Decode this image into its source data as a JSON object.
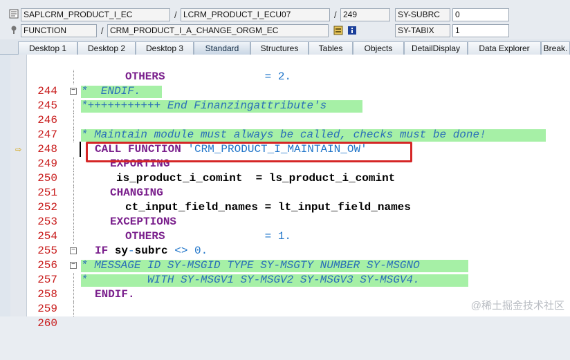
{
  "header": {
    "row1": {
      "program": "SAPLCRM_PRODUCT_I_EC",
      "include": "LCRM_PRODUCT_I_ECU07",
      "line": "249",
      "sysfield": "SY-SUBRC",
      "sysvalue": "0"
    },
    "row2": {
      "type": "FUNCTION",
      "object": "CRM_PRODUCT_I_A_CHANGE_ORGM_EC",
      "sysfield": "SY-TABIX",
      "sysvalue": "1"
    }
  },
  "tabs": [
    {
      "label": "Desktop 1"
    },
    {
      "label": "Desktop 2"
    },
    {
      "label": "Desktop 3"
    },
    {
      "label": "Standard"
    },
    {
      "label": "Structures"
    },
    {
      "label": "Tables"
    },
    {
      "label": "Objects"
    },
    {
      "label": "DetailDisplay"
    },
    {
      "label": "Data Explorer"
    },
    {
      "label": "Break."
    }
  ],
  "code_lines": [
    {
      "n": "244"
    },
    {
      "n": "245"
    },
    {
      "n": "246"
    },
    {
      "n": "247"
    },
    {
      "n": "248"
    },
    {
      "n": "249"
    },
    {
      "n": "250"
    },
    {
      "n": "251"
    },
    {
      "n": "252"
    },
    {
      "n": "253"
    },
    {
      "n": "254"
    },
    {
      "n": "255"
    },
    {
      "n": "256"
    },
    {
      "n": "257"
    },
    {
      "n": "258"
    },
    {
      "n": "259"
    },
    {
      "n": "260"
    }
  ],
  "code": {
    "l244a": "OTHERS",
    "l244b": "= ",
    "l244c": "2",
    "l244d": ".",
    "l245": "*  ENDIF.",
    "l246": "*+++++++++++ End Finanzingattribute's",
    "l248": "* Maintain module must always be called, checks must be done!",
    "l249a": "CALL FUNCTION ",
    "l249b": "'CRM_PRODUCT_I_MAINTAIN_OW'",
    "l250": "EXPORTING",
    "l251a": "is_product_i_comint",
    "l251b": "  = ",
    "l251c": "ls_product_i_comint",
    "l252": "CHANGING",
    "l253a": "ct_input_field_names",
    "l253b": " = ",
    "l253c": "lt_input_field_names",
    "l254": "EXCEPTIONS",
    "l255a": "OTHERS",
    "l255b": "= ",
    "l255c": "1",
    "l255d": ".",
    "l256a": "IF ",
    "l256b": "sy",
    "l256c": "-",
    "l256d": "subrc ",
    "l256e": "<> ",
    "l256f": "0",
    "l256g": ".",
    "l257": "* MESSAGE ID SY-MSGID TYPE SY-MSGTY NUMBER SY-MSGNO",
    "l258": "*         WITH SY-MSGV1 SY-MSGV2 SY-MSGV3 SY-MSGV4.",
    "l259": "ENDIF."
  },
  "watermark": "@稀土掘金技术社区",
  "colors": {
    "comment_bg": "#a6f0a6",
    "keyword": "#7a1f8c",
    "highlight_box": "#d52626",
    "line_number": "#c81b1b"
  }
}
